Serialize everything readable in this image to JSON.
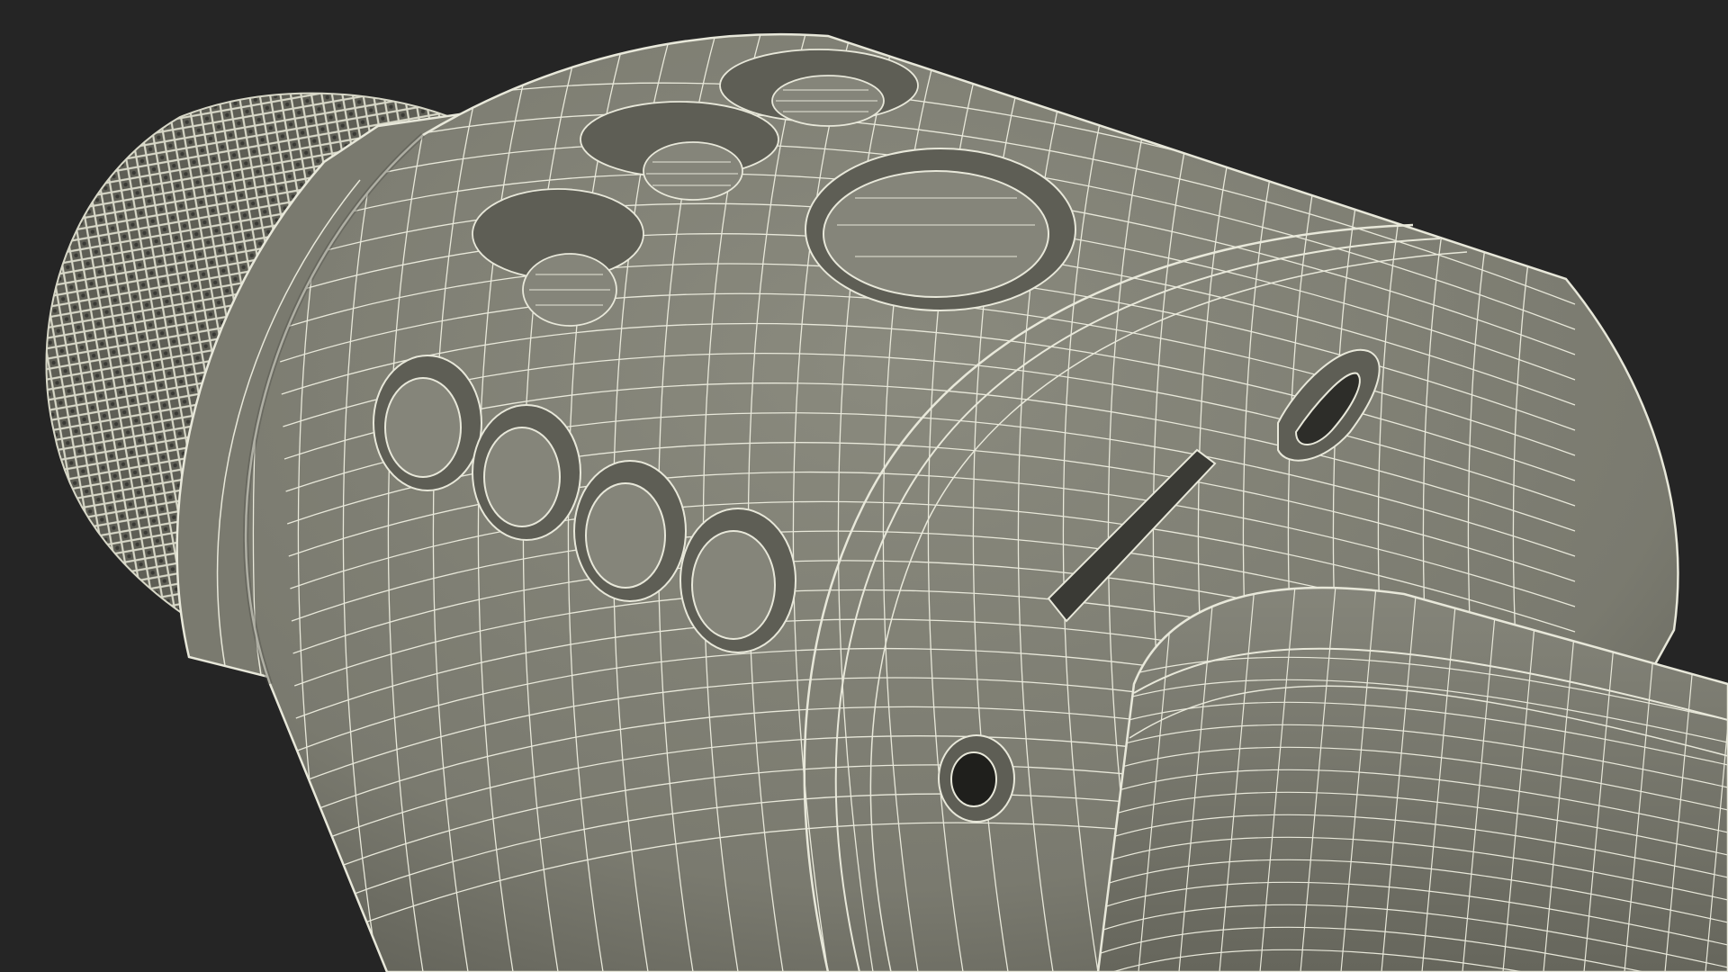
{
  "scene": {
    "subject": "wireframe-karaoke-microphone",
    "colors": {
      "background": "#252525",
      "surface": "#7d7d72",
      "surface_light": "#8a8a7e",
      "surface_dark": "#5e5e55",
      "shadow": "#45453f",
      "wire": "#e8e8da",
      "grille_dark": "#3a3a35"
    },
    "parts": [
      {
        "name": "grille-head",
        "label": ""
      },
      {
        "name": "collar-ring",
        "label": ""
      },
      {
        "name": "main-body",
        "label": ""
      },
      {
        "name": "control-buttons",
        "count": 4
      },
      {
        "name": "round-buttons",
        "count": 4
      },
      {
        "name": "large-oval-button",
        "label": ""
      },
      {
        "name": "usb-port",
        "label": ""
      },
      {
        "name": "card-slot",
        "label": ""
      },
      {
        "name": "audio-jack",
        "label": ""
      },
      {
        "name": "handle",
        "label": ""
      }
    ]
  }
}
